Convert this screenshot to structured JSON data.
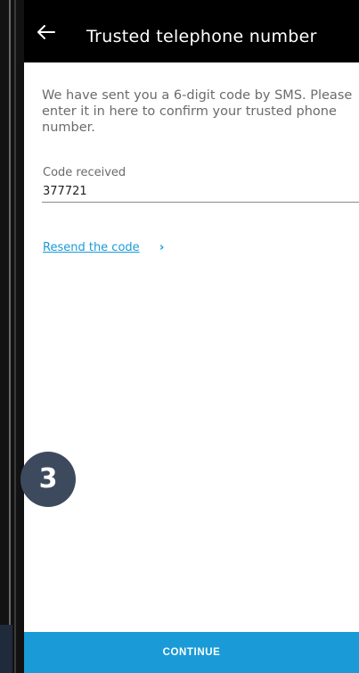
{
  "app_bar": {
    "title": "Trusted telephone number",
    "back_icon": "arrow-left-icon"
  },
  "content": {
    "instructions": "We have sent you a 6-digit code by SMS. Please enter it in here to confirm your trusted phone number.",
    "code_field": {
      "label": "Code received",
      "value": "377721"
    },
    "resend_link": {
      "label": "Resend the code",
      "icon": "chevron-right-icon"
    }
  },
  "step_badge": {
    "number": "3"
  },
  "footer": {
    "continue_label": "CONTINUE"
  },
  "colors": {
    "accent": "#1a9ad6",
    "app_bar_bg": "#000000",
    "badge_bg": "#3d4a5e",
    "body_text": "#6b6b6b"
  }
}
